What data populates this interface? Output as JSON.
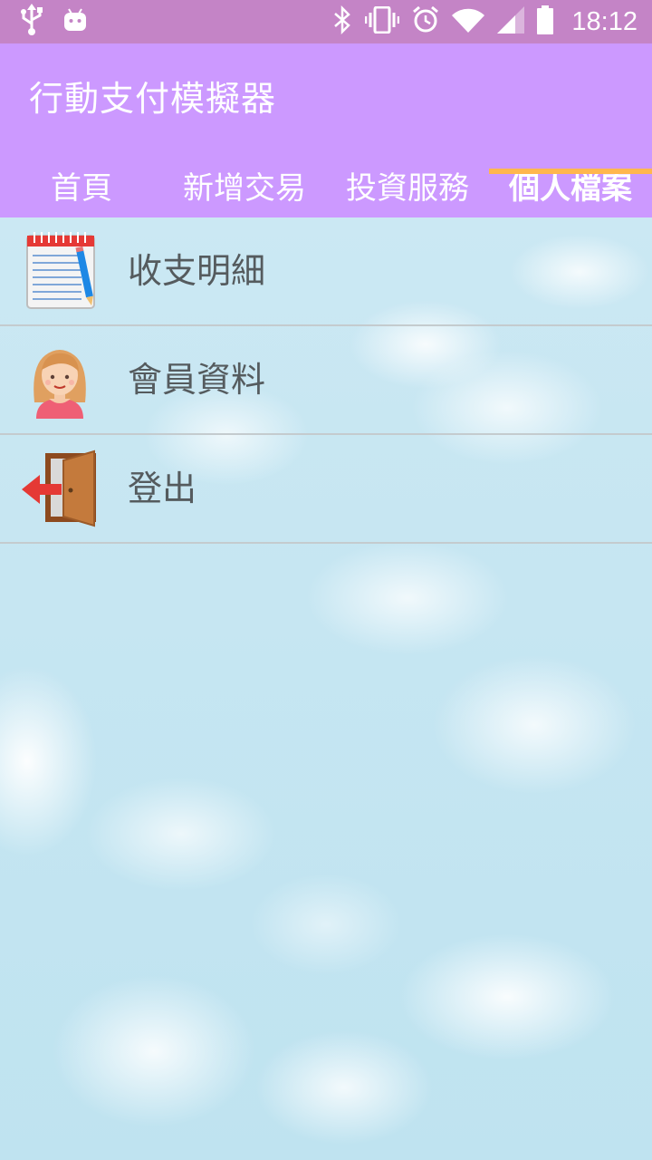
{
  "status_bar": {
    "time": "18:12",
    "icons": [
      "usb-icon",
      "android-icon",
      "bluetooth-icon",
      "vibrate-icon",
      "alarm-icon",
      "wifi-icon",
      "signal-icon",
      "battery-icon"
    ]
  },
  "app": {
    "title": "行動支付模擬器",
    "tabs": [
      {
        "label": "首頁",
        "active": false
      },
      {
        "label": "新增交易",
        "active": false
      },
      {
        "label": "投資服務",
        "active": false
      },
      {
        "label": "個人檔案",
        "active": true
      }
    ]
  },
  "menu": {
    "items": [
      {
        "label": "收支明細",
        "icon": "notepad-icon"
      },
      {
        "label": "會員資料",
        "icon": "girl-avatar-icon"
      },
      {
        "label": "登出",
        "icon": "exit-door-icon"
      }
    ]
  },
  "colors": {
    "status_bar": "#c484c6",
    "app_bar": "#cc99ff",
    "tab_indicator": "#ffb74d",
    "text_on_bar": "#ffffff",
    "menu_text": "#555b5e"
  }
}
